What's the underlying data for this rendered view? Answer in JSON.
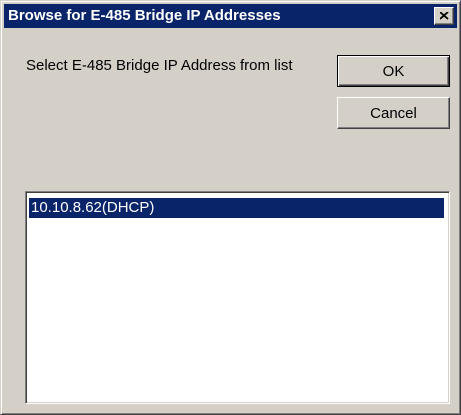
{
  "window": {
    "title": "Browse for E-485 Bridge IP Addresses",
    "close_icon": "close-icon"
  },
  "prompt_label": "Select E-485 Bridge IP Address from list",
  "buttons": {
    "ok_label": "OK",
    "cancel_label": "Cancel"
  },
  "address_list": {
    "items": [
      {
        "label": "10.10.8.62(DHCP)",
        "selected": true
      }
    ]
  },
  "colors": {
    "titlebar": "#0a246a",
    "face": "#d4d0c8",
    "selection": "#0a246a",
    "selection_text": "#ffffff"
  }
}
